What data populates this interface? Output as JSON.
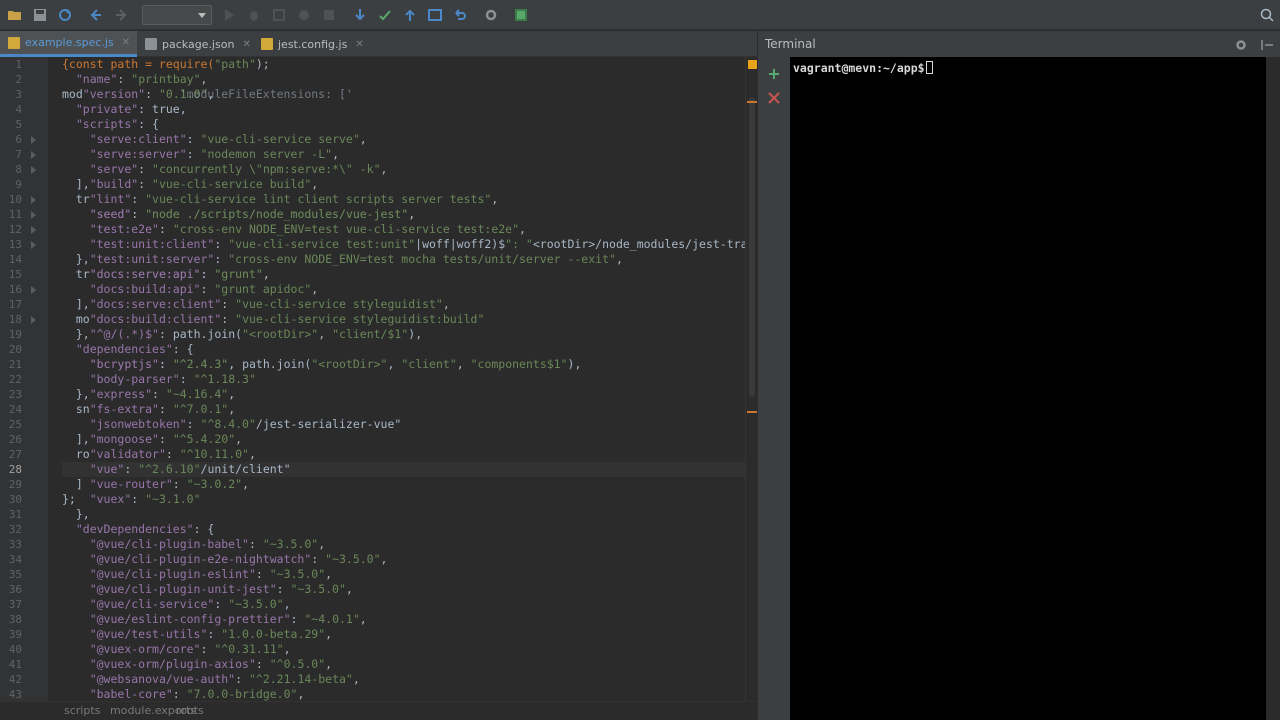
{
  "toolbar": {
    "icons": [
      "open-folder-icon",
      "save-icon",
      "sync-icon",
      "back-icon",
      "forward-icon",
      "run-icon",
      "debug-icon",
      "coverage-icon",
      "stop-icon",
      "vcs-update-icon",
      "vcs-commit-icon",
      "vcs-push-icon",
      "vcs-history-icon",
      "revert-icon",
      "settings-icon",
      "project-structure-icon",
      "search-icon"
    ],
    "run_config_value": ""
  },
  "tabs": [
    {
      "label": "example.spec.js",
      "type": "js",
      "active": true
    },
    {
      "label": "package.json",
      "type": "json",
      "active": false
    },
    {
      "label": "jest.config.js",
      "type": "js",
      "active": false
    }
  ],
  "editor": {
    "current_line": 28,
    "line_numbers": [
      "1",
      "2",
      "3",
      "4",
      "5",
      "6",
      "7",
      "8",
      "9",
      "10",
      "11",
      "12",
      "13",
      "14",
      "15",
      "16",
      "17",
      "18",
      "19",
      "20",
      "21",
      "22",
      "23",
      "24",
      "25",
      "26",
      "27",
      "28",
      "29",
      "30",
      "31",
      "32",
      "33",
      "34",
      "35",
      "36",
      "37",
      "38",
      "39",
      "40",
      "41",
      "42",
      "43"
    ],
    "lines": [
      "{const path = require(\"path\");",
      "  \"name\": \"printbay\",",
      "mod\"version\": \"0.1.0\",",
      "  \"private\": true,",
      "  \"scripts\": {",
      "    \"serve:client\": \"vue-cli-service serve\",",
      "    \"serve:server\": \"nodemon server -L\",",
      "    \"serve\": \"concurrently \\\"npm:serve:*\\\" -k\",",
      "  ],\"build\": \"vue-cli-service build\",",
      "  tr\"lint\": \"vue-cli-service lint client scripts server tests\",",
      "    \"seed\": \"node ./scripts/node_modules/vue-jest\",",
      "    \"test:e2e\": \"cross-env NODE_ENV=test vue-cli-service test:e2e\",",
      "    \"test:unit:client\": \"vue-cli-service test:unit\"|woff|woff2)$\": \"<rootDir>/node_modules/jest-trans",
      "  },\"test:unit:server\": \"cross-env NODE_ENV=test mocha tests/unit/server --exit\",",
      "  tr\"docs:serve:api\": \"grunt\",",
      "    \"docs:build:api\": \"grunt apidoc\",",
      "  ],\"docs:serve:client\": \"vue-cli-service styleguidist\",",
      "  mo\"docs:build:client\": \"vue-cli-service styleguidist:build\"",
      "  },\"^@/(.*)$\": path.join(\"<rootDir>\", \"client/$1\"),",
      "  \"dependencies\": {",
      "    \"bcryptjs\": \"^2.4.3\", path.join(\"<rootDir>\", \"client\", \"components$1\"),",
      "    \"body-parser\": \"^1.18.3\"",
      "  },\"express\": \"~4.16.4\",",
      "  sn\"fs-extra\": \"^7.0.1\",",
      "    \"jsonwebtoken\": \"^8.4.0\"/jest-serializer-vue\"",
      "  ],\"mongoose\": \"^5.4.20\",",
      "  ro\"validator\": \"^10.11.0\",",
      "    \"vue\": \"^2.6.10\"/unit/client\"",
      "  ] \"vue-router\": \"~3.0.2\",",
      "};  \"vuex\": \"~3.1.0\"",
      "  },",
      "  \"devDependencies\": {",
      "    \"@vue/cli-plugin-babel\": \"~3.5.0\",",
      "    \"@vue/cli-plugin-e2e-nightwatch\": \"~3.5.0\",",
      "    \"@vue/cli-plugin-eslint\": \"~3.5.0\",",
      "    \"@vue/cli-plugin-unit-jest\": \"~3.5.0\",",
      "    \"@vue/cli-service\": \"~3.5.0\",",
      "    \"@vue/eslint-config-prettier\": \"~4.0.1\",",
      "    \"@vue/test-utils\": \"1.0.0-beta.29\",",
      "    \"@vuex-orm/core\": \"^0.31.11\",",
      "    \"@vuex-orm/plugin-axios\": \"^0.5.0\",",
      "    \"@websanova/vue-auth\": \"^2.21.14-beta\",",
      "    \"babel-core\": \"7.0.0-bridge.0\","
    ],
    "ghost_lines": [
      {
        "line": 3,
        "text": "                 'moduleFileExtensions: ['"
      },
      {
        "line": 11,
        "text": "    \"seed\": \"node ./scripts/node_modules/vue-jest\","
      },
      {
        "line": 15,
        "text": "    \"docs:serve:api\": \"grunt\","
      },
      {
        "line": 21,
        "text": "    \"bcryptjs\": \"^2.4.3\","
      }
    ]
  },
  "breadcrumb": {
    "items": [
      "scripts",
      "module.exports",
      "roots"
    ]
  },
  "terminal": {
    "title": "Terminal",
    "prompt": "vagrant@mevn:~/app$"
  }
}
